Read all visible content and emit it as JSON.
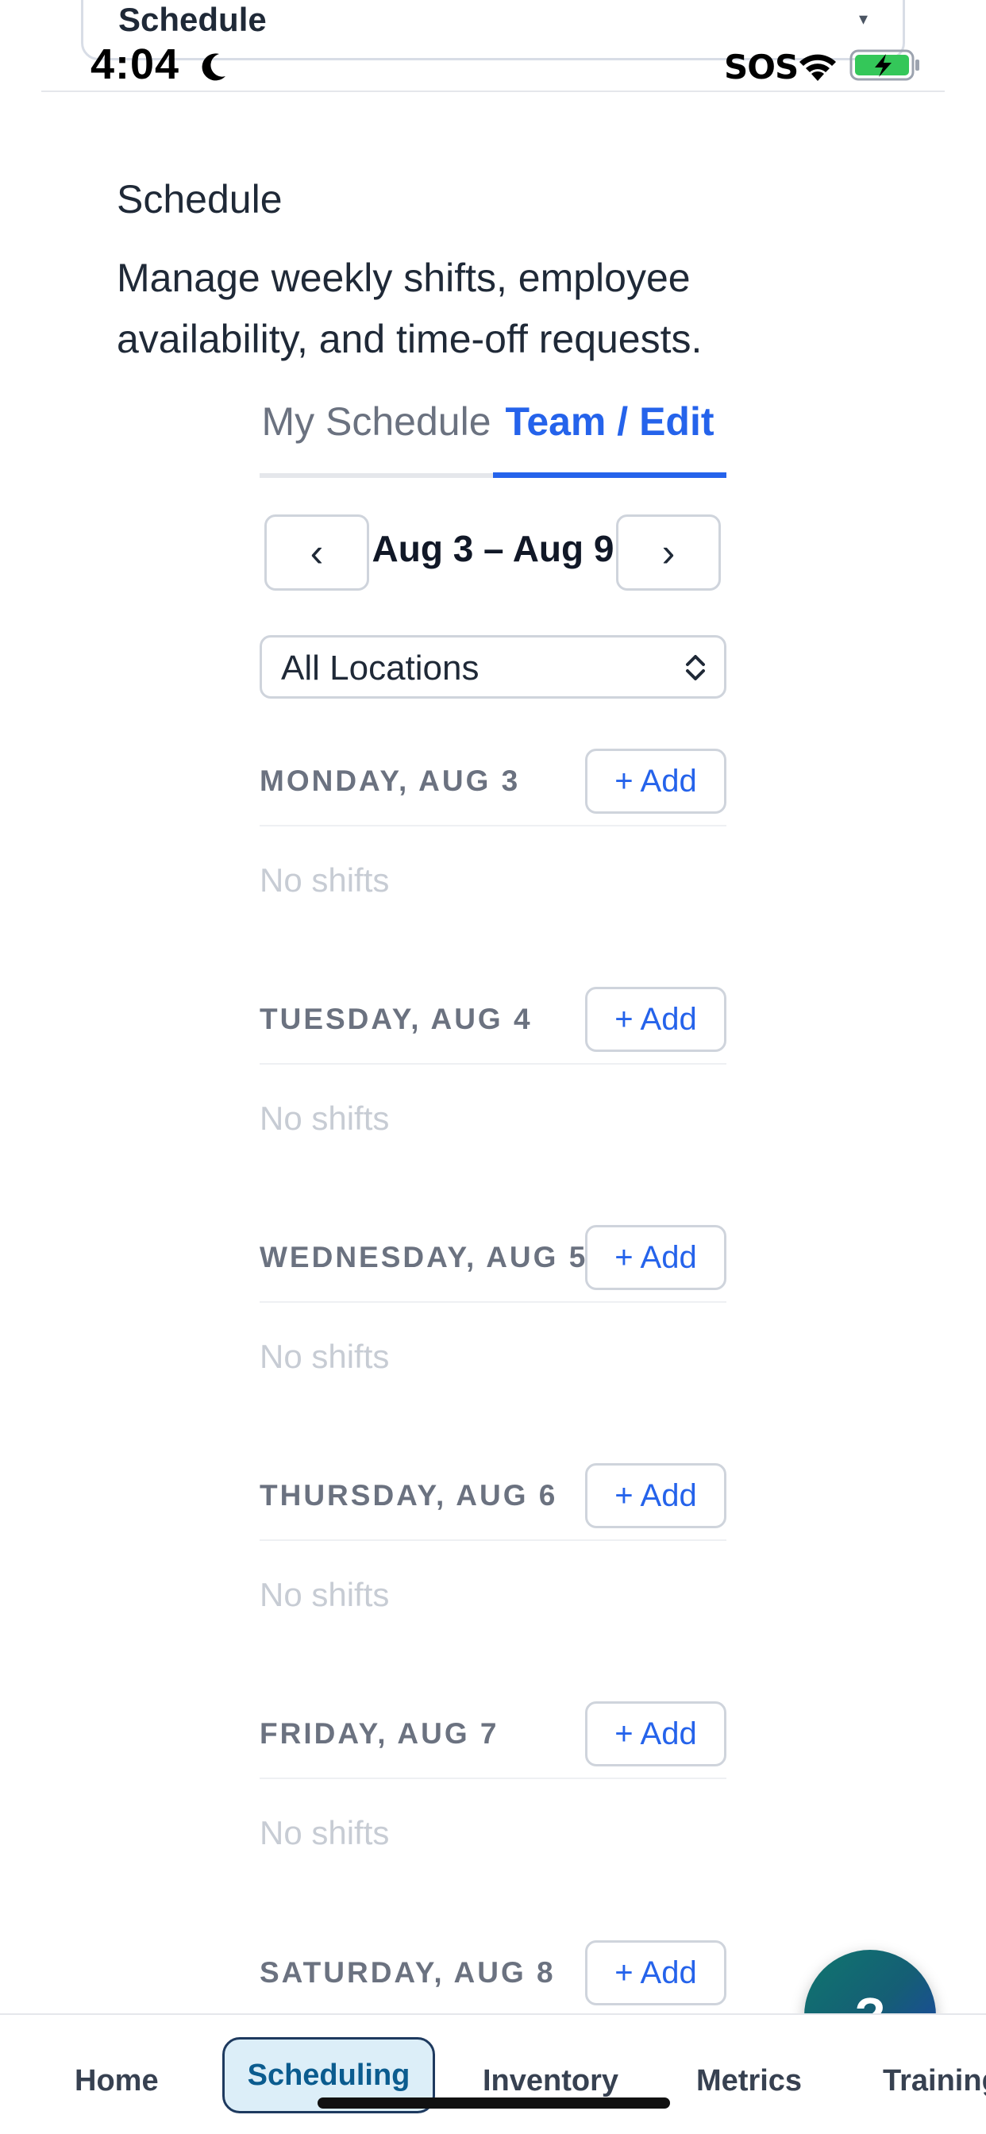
{
  "top_select": {
    "label": "Schedule",
    "caret": "▾"
  },
  "status_bar": {
    "time": "4:04",
    "carrier": "SOS"
  },
  "header": {
    "title": "Schedule",
    "description": "Manage weekly shifts, employee availability, and time-off requests."
  },
  "tabs": [
    {
      "label": "My Schedule",
      "active": false
    },
    {
      "label": "Team / Edit",
      "active": true
    }
  ],
  "week_nav": {
    "prev": "‹",
    "label": "Aug 3 – Aug 9",
    "next": "›"
  },
  "location_filter": {
    "value": "All Locations"
  },
  "days": [
    {
      "label": "MONDAY, AUG 3",
      "add_label": "+ Add",
      "empty_text": "No shifts"
    },
    {
      "label": "TUESDAY, AUG 4",
      "add_label": "+ Add",
      "empty_text": "No shifts"
    },
    {
      "label": "WEDNESDAY, AUG 5",
      "add_label": "+ Add",
      "empty_text": "No shifts"
    },
    {
      "label": "THURSDAY, AUG 6",
      "add_label": "+ Add",
      "empty_text": "No shifts"
    },
    {
      "label": "FRIDAY, AUG 7",
      "add_label": "+ Add",
      "empty_text": "No shifts"
    },
    {
      "label": "SATURDAY, AUG 8",
      "add_label": "+ Add"
    }
  ],
  "help_button": {
    "label": "?"
  },
  "tabbar": {
    "items": [
      {
        "label": "Home"
      },
      {
        "label": "Scheduling",
        "active": true
      },
      {
        "label": "Inventory"
      },
      {
        "label": "Metrics"
      },
      {
        "label": "Training"
      }
    ]
  },
  "colors": {
    "accent": "#2563eb",
    "muted_text": "#6b7280",
    "border": "#cfd4dc",
    "active_tab_bg": "#dceef8"
  }
}
